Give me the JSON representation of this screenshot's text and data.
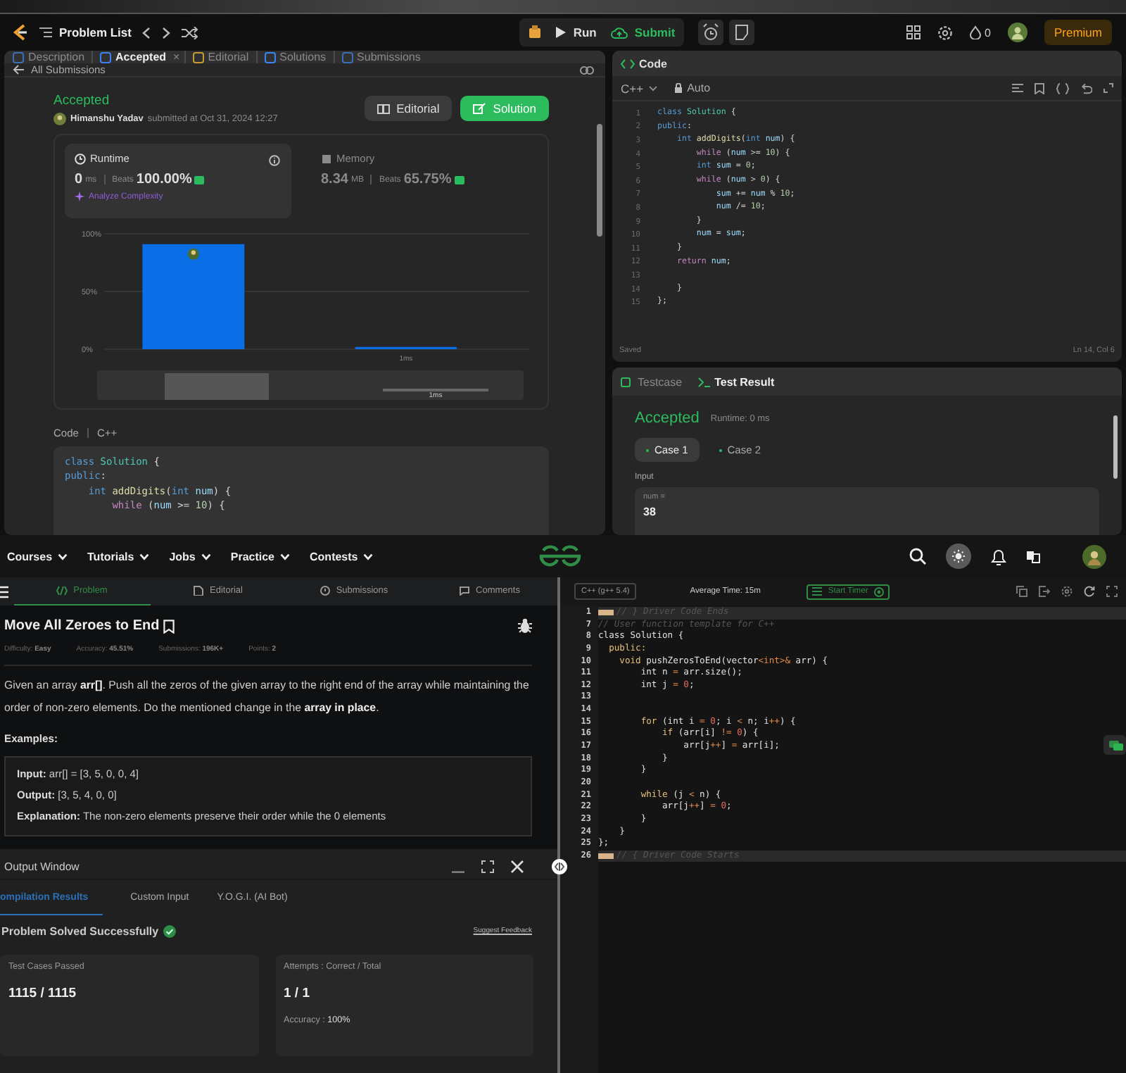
{
  "top_bar": {
    "problem_list": "Problem List",
    "run": "Run",
    "submit": "Submit",
    "streak": "0",
    "premium": "Premium"
  },
  "submission_panel": {
    "tabs": [
      {
        "label": "Description",
        "selected": false
      },
      {
        "label": "Accepted",
        "selected": true,
        "close": "×"
      },
      {
        "label": "Editorial",
        "selected": false
      },
      {
        "label": "Solutions",
        "selected": false
      },
      {
        "label": "Submissions",
        "selected": false
      }
    ],
    "back_link": "All Submissions",
    "status": "Accepted",
    "author": "Himanshu Yadav",
    "submitted": "submitted at Oct 31, 2024 12:27",
    "buttons": [
      {
        "label": "Editorial",
        "kind": "secondary"
      },
      {
        "label": "Solution",
        "kind": "primary"
      }
    ],
    "metrics": [
      {
        "kind": "runtime",
        "title": "Runtime",
        "value": "0",
        "unit": "ms",
        "beats_label": "Beats",
        "beats": "100.00%",
        "selected": true,
        "link": "Analyze Complexity"
      },
      {
        "kind": "memory",
        "title": "Memory",
        "value": "8.34",
        "unit": "MB",
        "beats_label": "Beats",
        "beats": "65.75%",
        "selected": false
      }
    ],
    "chart_data": {
      "type": "bar",
      "categories": [
        null,
        "1ms"
      ],
      "values": [
        91,
        2
      ],
      "ylim": [
        0,
        100
      ],
      "yticks": [
        {
          "value": 0,
          "label": "0%"
        },
        {
          "value": 50,
          "label": "50%"
        },
        {
          "value": 100,
          "label": "100%"
        }
      ]
    },
    "navigator_label": "1ms",
    "code_label": "Code",
    "language": "C++",
    "code": [
      [
        {
          "kind": "kw",
          "text": "class "
        },
        {
          "kind": "cls",
          "text": "Solution"
        },
        {
          "kind": "plain",
          "text": " {"
        }
      ],
      [
        {
          "kind": "kw",
          "text": "public"
        },
        {
          "kind": "plain",
          "text": ":"
        }
      ],
      [
        {
          "kind": "kw",
          "text": "    int "
        },
        {
          "kind": "fn",
          "text": "addDigits"
        },
        {
          "kind": "plain",
          "text": "("
        },
        {
          "kind": "kw",
          "text": "int "
        },
        {
          "kind": "var",
          "text": "num"
        },
        {
          "kind": "plain",
          "text": ") {"
        }
      ],
      [
        {
          "kind": "ctl",
          "text": "        while"
        },
        {
          "kind": "plain",
          "text": " ("
        },
        {
          "kind": "var",
          "text": "num"
        },
        {
          "kind": "plain",
          "text": " >= "
        },
        {
          "kind": "num",
          "text": "10"
        },
        {
          "kind": "plain",
          "text": ") {"
        }
      ]
    ]
  },
  "code_panel": {
    "title": "Code",
    "language": "C++",
    "mode": "Auto",
    "status": "Saved",
    "cursor": "Ln 14, Col 6",
    "lines": [
      {
        "n": "1",
        "t": [
          {
            "kind": "kw",
            "text": "class "
          },
          {
            "kind": "cls",
            "text": "Solution"
          },
          {
            "kind": "plain",
            "text": " {"
          }
        ]
      },
      {
        "n": "2",
        "t": [
          {
            "kind": "kw",
            "text": "public"
          },
          {
            "kind": "plain",
            "text": ":"
          }
        ]
      },
      {
        "n": "3",
        "t": [
          {
            "kind": "kw",
            "text": "    int "
          },
          {
            "kind": "fn",
            "text": "addDigits"
          },
          {
            "kind": "plain",
            "text": "("
          },
          {
            "kind": "kw",
            "text": "int "
          },
          {
            "kind": "var",
            "text": "num"
          },
          {
            "kind": "plain",
            "text": ") {"
          }
        ]
      },
      {
        "n": "4",
        "t": [
          {
            "kind": "ctl",
            "text": "        while"
          },
          {
            "kind": "plain",
            "text": " ("
          },
          {
            "kind": "var",
            "text": "num"
          },
          {
            "kind": "plain",
            "text": " >= "
          },
          {
            "kind": "num",
            "text": "10"
          },
          {
            "kind": "plain",
            "text": ") {"
          }
        ]
      },
      {
        "n": "5",
        "t": [
          {
            "kind": "kw",
            "text": "        int "
          },
          {
            "kind": "var",
            "text": "sum"
          },
          {
            "kind": "plain",
            "text": " = "
          },
          {
            "kind": "num",
            "text": "0"
          },
          {
            "kind": "plain",
            "text": ";"
          }
        ]
      },
      {
        "n": "6",
        "t": [
          {
            "kind": "ctl",
            "text": "        while"
          },
          {
            "kind": "plain",
            "text": " ("
          },
          {
            "kind": "var",
            "text": "num"
          },
          {
            "kind": "plain",
            "text": " > "
          },
          {
            "kind": "num",
            "text": "0"
          },
          {
            "kind": "plain",
            "text": ") {"
          }
        ]
      },
      {
        "n": "7",
        "t": [
          {
            "kind": "var",
            "text": "            sum"
          },
          {
            "kind": "plain",
            "text": " += "
          },
          {
            "kind": "var",
            "text": "num"
          },
          {
            "kind": "plain",
            "text": " % "
          },
          {
            "kind": "num",
            "text": "10"
          },
          {
            "kind": "plain",
            "text": ";"
          }
        ]
      },
      {
        "n": "8",
        "t": [
          {
            "kind": "var",
            "text": "            num"
          },
          {
            "kind": "plain",
            "text": " /= "
          },
          {
            "kind": "num",
            "text": "10"
          },
          {
            "kind": "plain",
            "text": ";"
          }
        ]
      },
      {
        "n": "9",
        "t": [
          {
            "kind": "plain",
            "text": "        }"
          }
        ]
      },
      {
        "n": "10",
        "t": [
          {
            "kind": "var",
            "text": "        num"
          },
          {
            "kind": "plain",
            "text": " = "
          },
          {
            "kind": "var",
            "text": "sum"
          },
          {
            "kind": "plain",
            "text": ";"
          }
        ]
      },
      {
        "n": "11",
        "t": [
          {
            "kind": "plain",
            "text": "    }"
          }
        ]
      },
      {
        "n": "12",
        "t": [
          {
            "kind": "ctl",
            "text": "    return "
          },
          {
            "kind": "var",
            "text": "num"
          },
          {
            "kind": "plain",
            "text": ";"
          }
        ]
      },
      {
        "n": "13"
      },
      {
        "n": "14",
        "t": [
          {
            "kind": "plain",
            "text": "    }"
          }
        ]
      },
      {
        "n": "15",
        "t": [
          {
            "kind": "plain",
            "text": "};"
          }
        ]
      }
    ]
  },
  "result_panel": {
    "tabs": [
      {
        "label": "Testcase",
        "selected": false
      },
      {
        "label": "Test Result",
        "selected": true
      }
    ],
    "verdict": "Accepted",
    "runtime": "Runtime: 0 ms",
    "cases": [
      {
        "label": "Case 1",
        "selected": true
      },
      {
        "label": "Case 2",
        "selected": false
      }
    ],
    "input_label": "Input",
    "param": "num =",
    "value": "38"
  },
  "site_nav": {
    "menus": [
      "Courses",
      "Tutorials",
      "Jobs",
      "Practice",
      "Contests"
    ]
  },
  "problem_tabs": [
    {
      "label": "Problem",
      "selected": true
    },
    {
      "label": "Editorial",
      "selected": false
    },
    {
      "label": "Submissions",
      "selected": false
    },
    {
      "label": "Comments",
      "selected": false
    }
  ],
  "problem": {
    "title": "Move All Zeroes to End",
    "meta": [
      "Difficulty: **Easy**",
      "Accuracy: **45.51%**",
      "Submissions: **196K+**",
      "Points: **2**"
    ],
    "statement": "Given an array **arr[]**. Push all the zeros of the given array to the right end of the array while maintaining the order of non-zero elements. Do the mentioned change in the **array in place**.",
    "examples_label": "Examples:",
    "example": [
      "**Input:** arr[] = [3, 5, 0, 0, 4]",
      "**Output:** [3, 5, 4, 0, 0]",
      "**Explanation:** The non-zero elements preserve their order while the 0 elements"
    ]
  },
  "output_window": {
    "title": "Output Window",
    "tabs": [
      {
        "label": "ompilation Results",
        "selected": true
      },
      {
        "label": "Custom Input",
        "selected": false
      },
      {
        "label": "Y.O.G.I. (AI Bot)",
        "selected": false
      }
    ],
    "result": "Problem Solved Successfully",
    "feedback": "Suggest Feedback",
    "cards": [
      {
        "label": "Test Cases Passed",
        "value": "1115 / 1115"
      },
      {
        "label": "Attempts : Correct / Total",
        "value": "1 / 1",
        "note": "Accuracy : **100%**"
      }
    ]
  },
  "editor": {
    "language": "C++ (g++ 5.4)",
    "average_time": "Average Time: 15m",
    "timer": "Start Timer",
    "lines": [
      {
        "n": "1",
        "fold": true,
        "t": [
          {
            "kind": "cmt",
            "text": "// } Driver Code Ends"
          }
        ]
      },
      {
        "n": "7",
        "fold": false,
        "t": [
          {
            "kind": "cmt",
            "text": "// User function template for C++"
          }
        ]
      },
      {
        "n": "8",
        "fold": false,
        "t": [
          {
            "kind": "plain",
            "text": "class Solution {"
          }
        ]
      },
      {
        "n": "9",
        "fold": false,
        "t": [
          {
            "kind": "kw",
            "text": "  public:"
          }
        ]
      },
      {
        "n": "10",
        "fold": false,
        "t": [
          {
            "kind": "kw",
            "text": "    void"
          },
          {
            "kind": "plain",
            "text": " pushZerosToEnd(vector"
          },
          {
            "kind": "op",
            "text": "<int>&"
          },
          {
            "kind": "plain",
            "text": " arr) {"
          }
        ]
      },
      {
        "n": "11",
        "fold": false,
        "t": [
          {
            "kind": "plain",
            "text": "        int n "
          },
          {
            "kind": "op",
            "text": "="
          },
          {
            "kind": "plain",
            "text": " arr.size();"
          }
        ]
      },
      {
        "n": "12",
        "fold": false,
        "t": [
          {
            "kind": "plain",
            "text": "        int j "
          },
          {
            "kind": "op",
            "text": "="
          },
          {
            "kind": "num",
            "text": " 0"
          },
          {
            "kind": "plain",
            "text": ";"
          }
        ]
      },
      {
        "n": "13",
        "fold": false
      },
      {
        "n": "14",
        "fold": false
      },
      {
        "n": "15",
        "fold": false,
        "t": [
          {
            "kind": "kw",
            "text": "        for"
          },
          {
            "kind": "plain",
            "text": " (int i "
          },
          {
            "kind": "op",
            "text": "="
          },
          {
            "kind": "num",
            "text": " 0"
          },
          {
            "kind": "plain",
            "text": "; i "
          },
          {
            "kind": "op",
            "text": "<"
          },
          {
            "kind": "plain",
            "text": " n; i"
          },
          {
            "kind": "op",
            "text": "++"
          },
          {
            "kind": "plain",
            "text": ") {"
          }
        ]
      },
      {
        "n": "16",
        "fold": false,
        "t": [
          {
            "kind": "kw",
            "text": "            if"
          },
          {
            "kind": "plain",
            "text": " (arr[i] "
          },
          {
            "kind": "op",
            "text": "!="
          },
          {
            "kind": "num",
            "text": " 0"
          },
          {
            "kind": "plain",
            "text": ") {"
          }
        ]
      },
      {
        "n": "17",
        "fold": false,
        "t": [
          {
            "kind": "plain",
            "text": "                arr[j"
          },
          {
            "kind": "op",
            "text": "++"
          },
          {
            "kind": "plain",
            "text": "] "
          },
          {
            "kind": "op",
            "text": "="
          },
          {
            "kind": "plain",
            "text": " arr[i];"
          }
        ]
      },
      {
        "n": "18",
        "fold": false,
        "t": [
          {
            "kind": "plain",
            "text": "            }"
          }
        ]
      },
      {
        "n": "19",
        "fold": false,
        "t": [
          {
            "kind": "plain",
            "text": "        }"
          }
        ]
      },
      {
        "n": "20",
        "fold": false
      },
      {
        "n": "21",
        "fold": false,
        "t": [
          {
            "kind": "kw",
            "text": "        while"
          },
          {
            "kind": "plain",
            "text": " (j "
          },
          {
            "kind": "op",
            "text": "<"
          },
          {
            "kind": "plain",
            "text": " n) {"
          }
        ]
      },
      {
        "n": "22",
        "fold": false,
        "t": [
          {
            "kind": "plain",
            "text": "            arr[j"
          },
          {
            "kind": "op",
            "text": "++"
          },
          {
            "kind": "plain",
            "text": "] "
          },
          {
            "kind": "op",
            "text": "="
          },
          {
            "kind": "num",
            "text": " 0"
          },
          {
            "kind": "plain",
            "text": ";"
          }
        ]
      },
      {
        "n": "23",
        "fold": false,
        "t": [
          {
            "kind": "plain",
            "text": "        }"
          }
        ]
      },
      {
        "n": "24",
        "fold": false,
        "t": [
          {
            "kind": "plain",
            "text": "    }"
          }
        ]
      },
      {
        "n": "25",
        "fold": false,
        "t": [
          {
            "kind": "plain",
            "text": "};"
          }
        ]
      },
      {
        "n": "26",
        "fold": true,
        "t": [
          {
            "kind": "cmt",
            "text": "// { Driver Code Starts"
          }
        ]
      }
    ]
  }
}
